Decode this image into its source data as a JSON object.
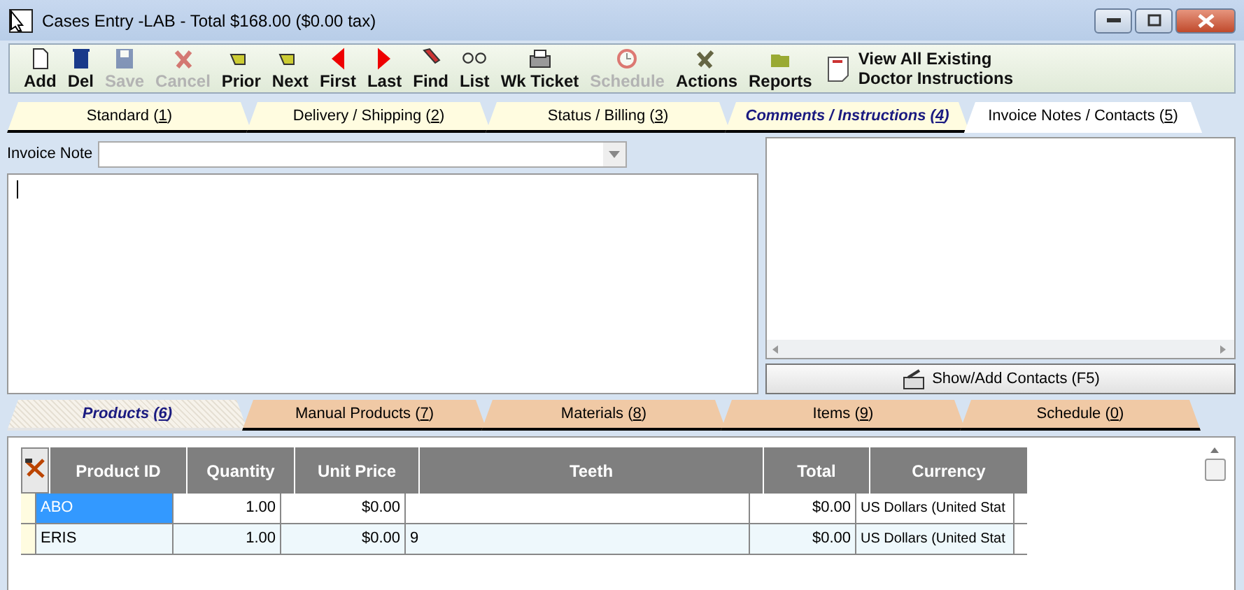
{
  "window": {
    "title": "Cases Entry -LAB - Total $168.00 ($0.00 tax)"
  },
  "toolbar": [
    {
      "label": "Add",
      "disabled": false
    },
    {
      "label": "Del",
      "disabled": false
    },
    {
      "label": "Save",
      "disabled": true
    },
    {
      "label": "Cancel",
      "disabled": true
    },
    {
      "label": "Prior",
      "disabled": false
    },
    {
      "label": "Next",
      "disabled": false
    },
    {
      "label": "First",
      "disabled": false
    },
    {
      "label": "Last",
      "disabled": false
    },
    {
      "label": "Find",
      "disabled": false
    },
    {
      "label": "List",
      "disabled": false
    },
    {
      "label": "Wk Ticket",
      "disabled": false
    },
    {
      "label": "Schedule",
      "disabled": true
    },
    {
      "label": "Actions",
      "disabled": false
    },
    {
      "label": "Reports",
      "disabled": false
    }
  ],
  "instructions_link": {
    "lines": [
      "View All Existing",
      "Doctor Instructions"
    ]
  },
  "top_tabs": [
    {
      "before": "Standard (",
      "key": "1",
      "after": ")",
      "selected": false,
      "has_content": false
    },
    {
      "before": "Delivery / Shipping (",
      "key": "2",
      "after": ")",
      "selected": false,
      "has_content": false
    },
    {
      "before": "Status / Billing (",
      "key": "3",
      "after": ")",
      "selected": false,
      "has_content": false
    },
    {
      "before": "Comments / Instructions (",
      "key": "4",
      "after": ")",
      "selected": false,
      "has_content": true
    },
    {
      "before": "Invoice Notes / Contacts (",
      "key": "5",
      "after": ")",
      "selected": true,
      "has_content": false
    }
  ],
  "invoice_note": {
    "label": "Invoice Note"
  },
  "contacts_button": {
    "label": "Show/Add Contacts (F5)"
  },
  "bottom_tabs": [
    {
      "before": "Products (",
      "key": "6",
      "after": ")",
      "selected": true,
      "has_content": true
    },
    {
      "before": "Manual Products (",
      "key": "7",
      "after": ")",
      "selected": false,
      "has_content": false
    },
    {
      "before": "Materials (",
      "key": "8",
      "after": ")",
      "selected": false,
      "has_content": false
    },
    {
      "before": "Items (",
      "key": "9",
      "after": ")",
      "selected": false,
      "has_content": false
    },
    {
      "before": "Schedule (",
      "key": "0",
      "after": ")",
      "selected": false,
      "has_content": false
    }
  ],
  "table": {
    "columns": [
      "Product ID",
      "Quantity",
      "Unit Price",
      "Teeth",
      "Total",
      "Currency"
    ],
    "rows": [
      {
        "cells": [
          "ABO",
          "1.00",
          "$0.00",
          "",
          "$0.00",
          "US Dollars  (United Stat"
        ],
        "selected": true
      },
      {
        "cells": [
          "ERIS",
          "1.00",
          "$0.00",
          "9",
          "$0.00",
          "US Dollars  (United Stat"
        ],
        "selected": false
      }
    ]
  }
}
